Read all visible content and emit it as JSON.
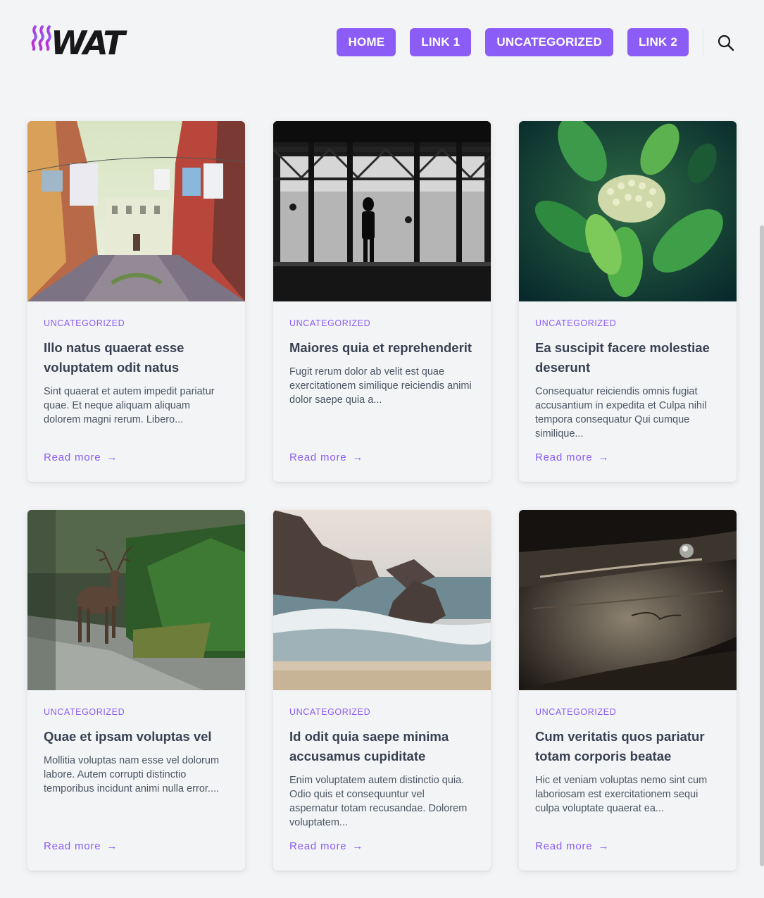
{
  "header": {
    "logo_text": "WAT",
    "nav": [
      "HOME",
      "LINK 1",
      "UNCATEGORIZED",
      "LINK 2"
    ]
  },
  "colors": {
    "accent": "#8b5cf6",
    "background": "#f3f4f6",
    "text": "#374151"
  },
  "icons": {
    "search": "search-icon",
    "read_more": "arrow-right-icon"
  },
  "posts": [
    {
      "category": "UNCATEGORIZED",
      "title": "Illo natus quaerat esse voluptatem odit natus",
      "excerpt": "Sint quaerat et autem impedit pariatur quae. Et neque aliquam aliquam dolorem magni rerum. Libero...",
      "read_more": "Read more",
      "image": "street-laundry-photo"
    },
    {
      "category": "UNCATEGORIZED",
      "title": "Maiores quia et reprehenderit",
      "excerpt": "Fugit rerum dolor ab velit est quae exercitationem similique reiciendis animi dolor saepe quia a...",
      "read_more": "Read more",
      "image": "silhouette-window-photo"
    },
    {
      "category": "UNCATEGORIZED",
      "title": "Ea suscipit facere molestiae deserunt",
      "excerpt": "Consequatur reiciendis omnis fugiat accusantium in expedita et Culpa nihil tempora consequatur Qui cumque similique...",
      "read_more": "Read more",
      "image": "green-plant-photo"
    },
    {
      "category": "UNCATEGORIZED",
      "title": "Quae et ipsam voluptas vel",
      "excerpt": "Mollitia voluptas nam esse vel dolorum labore. Autem corrupti distinctio temporibus incidunt animi nulla error....",
      "read_more": "Read more",
      "image": "deer-river-photo"
    },
    {
      "category": "UNCATEGORIZED",
      "title": "Id odit quia saepe minima accusamus cupiditate",
      "excerpt": "Enim voluptatem autem distinctio quia. Odio quis et consequuntur vel aspernatur totam recusandae. Dolorem voluptatem...",
      "read_more": "Read more",
      "image": "rocky-beach-photo"
    },
    {
      "category": "UNCATEGORIZED",
      "title": "Cum veritatis quos pariatur totam corporis beatae",
      "excerpt": "Hic et veniam voluptas nemo sint cum laboriosam est exercitationem sequi culpa voluptate quaerat ea...",
      "read_more": "Read more",
      "image": "vintage-car-photo"
    }
  ]
}
